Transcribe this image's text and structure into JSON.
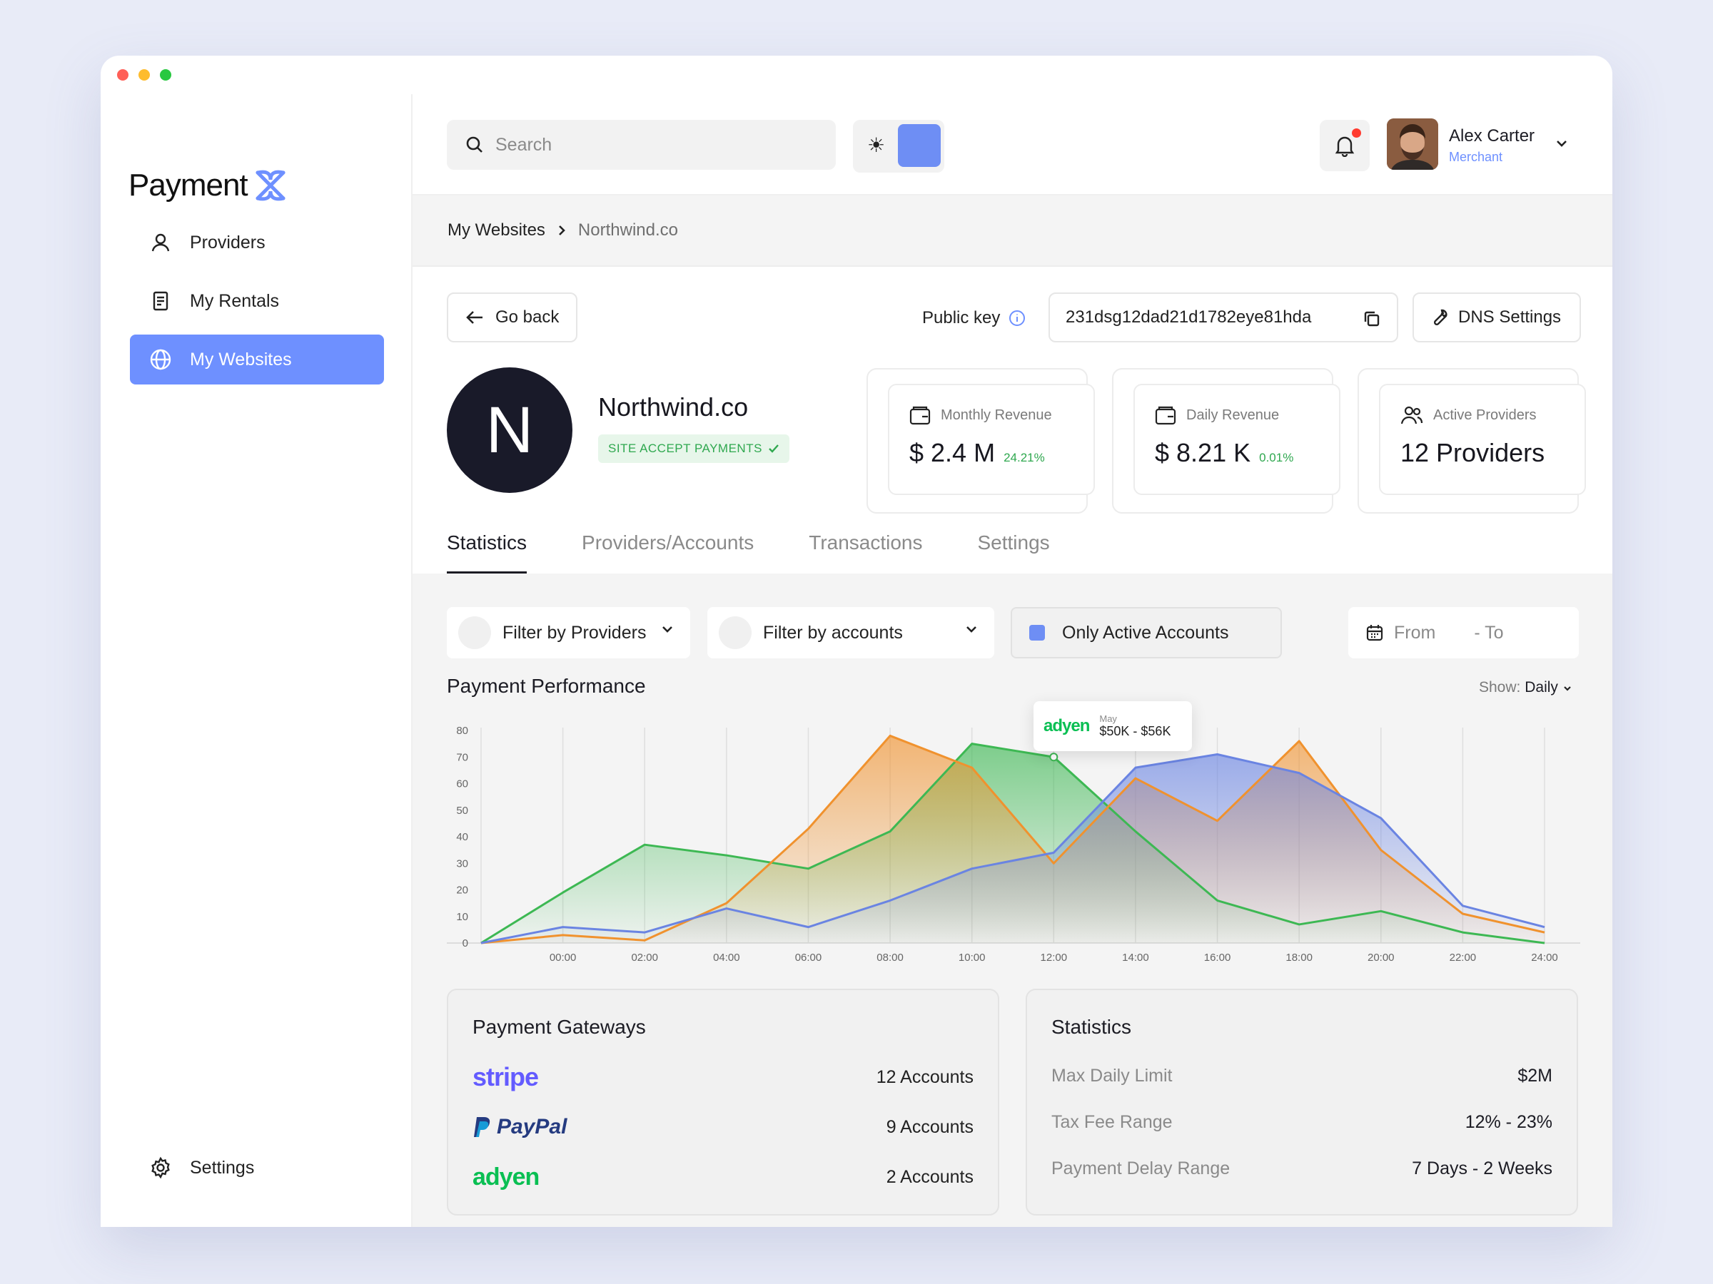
{
  "app": {
    "logo_text": "Payment",
    "colors": {
      "accent": "#6e90ff",
      "dark": "#191a29",
      "green": "#2fa84f",
      "orange": "#f0922e",
      "blue": "#6a84e2"
    }
  },
  "sidebar": {
    "items": [
      {
        "label": "Providers",
        "icon": "user-icon"
      },
      {
        "label": "My Rentals",
        "icon": "document-icon"
      },
      {
        "label": "My Websites",
        "icon": "globe-icon",
        "active": true
      }
    ],
    "settings_label": "Settings"
  },
  "header": {
    "search_placeholder": "Search",
    "user": {
      "name": "Alex Carter",
      "role": "Merchant"
    }
  },
  "breadcrumb": {
    "parent": "My Websites",
    "current": "Northwind.co"
  },
  "toolbar": {
    "back_label": "Go back",
    "public_key_label": "Public key",
    "public_key_value": "231dsg12dad21d1782eye81hda",
    "dns_label": "DNS Settings"
  },
  "site": {
    "logo_letter": "N",
    "name": "Northwind.co",
    "badge": "SITE ACCEPT PAYMENTS"
  },
  "stats_cards": [
    {
      "title": "Monthly Revenue",
      "value": "$ 2.4 M",
      "delta": "24.21%"
    },
    {
      "title": "Daily Revenue",
      "value": "$ 8.21 K",
      "delta": "0.01%"
    },
    {
      "title": "Active Providers",
      "value": "12 Providers",
      "delta": ""
    }
  ],
  "tabs": [
    "Statistics",
    "Providers/Accounts",
    "Transactions",
    "Settings"
  ],
  "filters": {
    "providers": "Filter by Providers",
    "accounts": "Filter by accounts",
    "only_active": "Only Active Accounts",
    "from": "From",
    "to": "- To"
  },
  "performance": {
    "title": "Payment Performance",
    "show_label": "Show:",
    "show_value": "Daily"
  },
  "chart_data": {
    "type": "area",
    "title": "Payment Performance",
    "x": [
      "",
      "00:00",
      "02:00",
      "04:00",
      "06:00",
      "08:00",
      "10:00",
      "12:00",
      "14:00",
      "16:00",
      "18:00",
      "20:00",
      "22:00",
      "24:00"
    ],
    "yticks": [
      0,
      10,
      20,
      30,
      40,
      50,
      60,
      70,
      80
    ],
    "ylim": [
      0,
      80
    ],
    "grid": true,
    "series": [
      {
        "color": "#3db853",
        "values": [
          0,
          19,
          37,
          33,
          28,
          42,
          75,
          70,
          42,
          16,
          7,
          12,
          4,
          0
        ]
      },
      {
        "color": "#f0922e",
        "values": [
          0,
          3,
          1,
          15,
          43,
          78,
          66,
          30,
          62,
          46,
          76,
          35,
          11,
          4
        ]
      },
      {
        "color": "#6a84e2",
        "values": [
          0,
          6,
          4,
          13,
          6,
          16,
          28,
          34,
          66,
          71,
          64,
          47,
          14,
          6
        ]
      }
    ],
    "tooltip": {
      "provider": "adyen",
      "month": "May",
      "range": "$50K - $56K"
    }
  },
  "gateways": {
    "title": "Payment Gateways",
    "rows": [
      {
        "name": "stripe",
        "accounts": "12 Accounts"
      },
      {
        "name": "PayPal",
        "accounts": "9 Accounts"
      },
      {
        "name": "adyen",
        "accounts": "2 Accounts"
      }
    ]
  },
  "statistics": {
    "title": "Statistics",
    "rows": [
      {
        "key": "Max Daily Limit",
        "value": "$2M"
      },
      {
        "key": "Tax Fee Range",
        "value": "12% - 23%"
      },
      {
        "key": "Payment Delay Range",
        "value": "7 Days - 2 Weeks"
      }
    ]
  }
}
